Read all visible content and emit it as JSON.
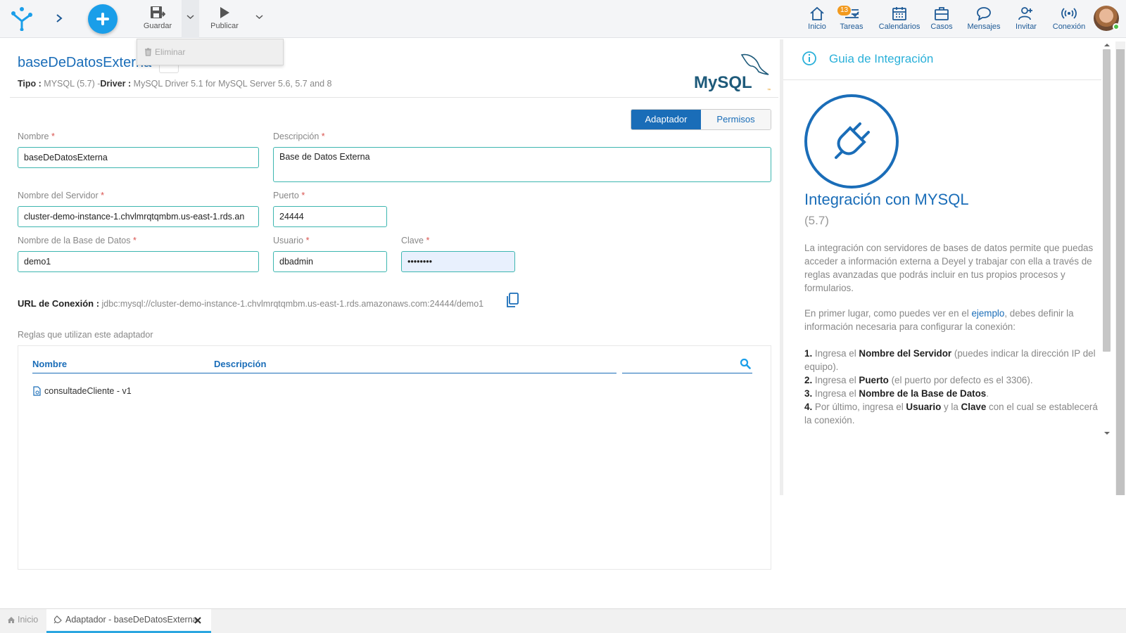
{
  "toolbar": {
    "save_label": "Guardar",
    "publish_label": "Publicar",
    "delete_label": "Eliminar"
  },
  "nav": {
    "inicio": "Inicio",
    "tareas": "Tareas",
    "tareas_badge": "13",
    "calendarios": "Calendarios",
    "casos": "Casos",
    "mensajes": "Mensajes",
    "invitar": "Invitar",
    "conexion": "Conexión"
  },
  "header": {
    "title": "baseDeDatosExterna",
    "tipo_label": "Tipo :",
    "tipo_value": "MYSQL (5.7)",
    "driver_label": "Driver :",
    "driver_value": "MySQL Driver 5.1 for MySQL Server 5.6, 5.7 and 8",
    "logo_text": "MySQL"
  },
  "tabs": {
    "adaptador": "Adaptador",
    "permisos": "Permisos"
  },
  "form": {
    "nombre_label": "Nombre",
    "nombre_value": "baseDeDatosExterna",
    "descripcion_label": "Descripción",
    "descripcion_value": "Base de Datos Externa",
    "servidor_label": "Nombre del Servidor",
    "servidor_value": "cluster-demo-instance-1.chvlmrqtqmbm.us-east-1.rds.an",
    "puerto_label": "Puerto",
    "puerto_value": "24444",
    "basedatos_label": "Nombre de la Base de Datos",
    "basedatos_value": "demo1",
    "usuario_label": "Usuario",
    "usuario_value": "dbadmin",
    "clave_label": "Clave",
    "clave_value": "••••••••",
    "required_mark": "*"
  },
  "url": {
    "label": "URL de Conexión :",
    "value": "jdbc:mysql://cluster-demo-instance-1.chvlmrqtqmbm.us-east-1.rds.amazonaws.com:24444/demo1"
  },
  "rules": {
    "section_label": "Reglas que utilizan este adaptador",
    "col_nombre": "Nombre",
    "col_descripcion": "Descripción",
    "items": [
      {
        "label": "consultadeCliente - v1"
      }
    ]
  },
  "guide": {
    "header": "Guia de Integración",
    "title": "Integración con MYSQL",
    "version": "(5.7)",
    "p1": "La integración con servidores de bases de datos permite que puedas acceder a información externa a Deyel y trabajar con ella a través de reglas avanzadas que podrás incluir en tus propios procesos y formularios.",
    "p2_a": "En primer lugar, como puedes ver en el ",
    "p2_link": "ejemplo",
    "p2_b": ", debes definir la información necesaria para configurar la conexión:",
    "steps": [
      {
        "num": "1.",
        "a": " Ingresa el ",
        "b": "Nombre del Servidor",
        "c": " (puedes indicar la dirección IP del equipo)."
      },
      {
        "num": "2.",
        "a": " Ingresa el ",
        "b": "Puerto",
        "c": " (el puerto por defecto es el 3306)."
      },
      {
        "num": "3.",
        "a": " Ingresa el ",
        "b": "Nombre de la Base de Datos",
        "c": "."
      },
      {
        "num": "4.",
        "a": " Por último, ingresa el ",
        "b": "Usuario",
        "c": " y la ",
        "d": "Clave",
        "e": " con el cual se establecerá la conexión."
      }
    ]
  },
  "bottom_tabs": {
    "home": "Inicio",
    "active": "Adaptador - baseDeDatosExterna"
  },
  "colors": {
    "primary": "#1a6db8",
    "accent": "#1a9ee9",
    "input_border": "#3db6b0",
    "badge": "#f29a1f"
  }
}
